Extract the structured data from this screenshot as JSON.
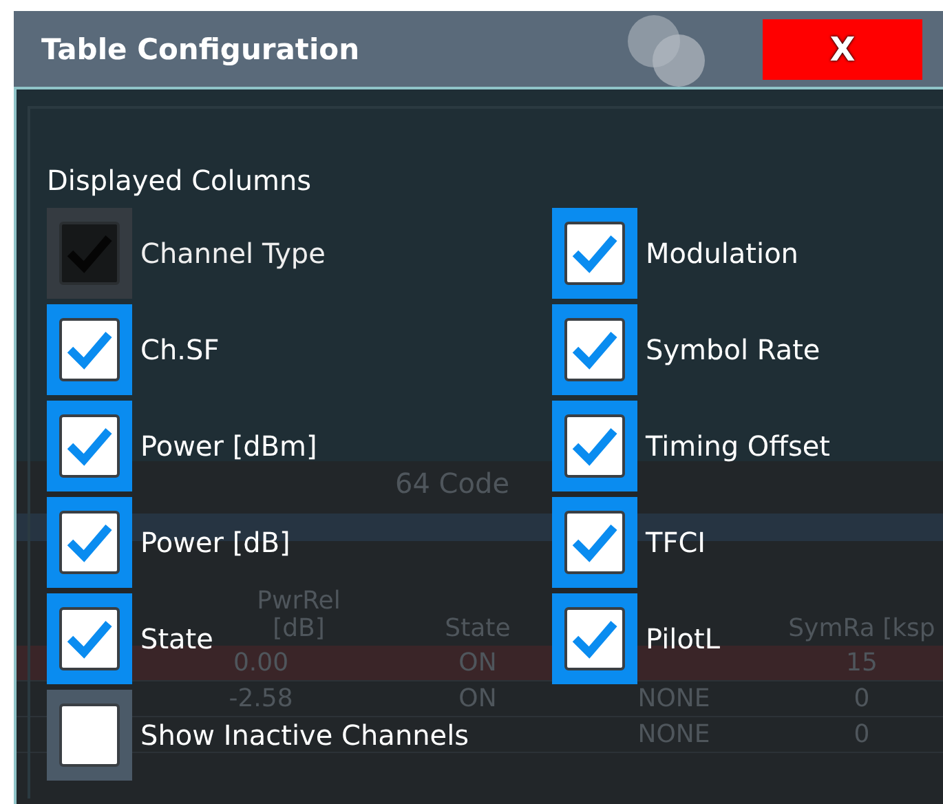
{
  "window": {
    "title": "Table Configuration",
    "close_label": "X"
  },
  "background_table": {
    "title": "64 Code",
    "columns": [
      {
        "kind": "pwr_rel",
        "label": "PwrRel [dB]"
      },
      {
        "kind": "state",
        "label": "State"
      },
      {
        "kind": "mod_type"
      },
      {
        "kind": "sym_rate",
        "label": "SymRa [ksp"
      }
    ],
    "rows": [
      {
        "highlighted": true,
        "pwr_rel": "0.00",
        "state": "ON",
        "sym_rate": "15"
      },
      {
        "highlighted": false,
        "pwr_rel": "-2.58",
        "state": "ON",
        "mod_type": "NONE",
        "sym_rate": "0"
      },
      {
        "highlighted": false,
        "mod_type": "NONE",
        "sym_rate": "0"
      }
    ]
  },
  "section_label": "Displayed Columns",
  "columns": [
    {
      "label": "Channel Type",
      "checked": true,
      "disabled": true
    },
    {
      "label": "Modulation",
      "checked": true,
      "disabled": false
    },
    {
      "label": "Ch.SF",
      "checked": true,
      "disabled": false
    },
    {
      "label": "Symbol Rate",
      "checked": true,
      "disabled": false
    },
    {
      "label": "Power [dBm]",
      "checked": true,
      "disabled": false
    },
    {
      "label": "Timing Offset",
      "checked": true,
      "disabled": false
    },
    {
      "label": "Power [dB]",
      "checked": true,
      "disabled": false
    },
    {
      "label": "TFCI",
      "checked": true,
      "disabled": false
    },
    {
      "label": "State",
      "checked": true,
      "disabled": false
    },
    {
      "label": "PilotL",
      "checked": true,
      "disabled": false
    }
  ],
  "show_inactive_channels": {
    "label": "Show Inactive Channels",
    "checked": false,
    "disabled": false
  }
}
